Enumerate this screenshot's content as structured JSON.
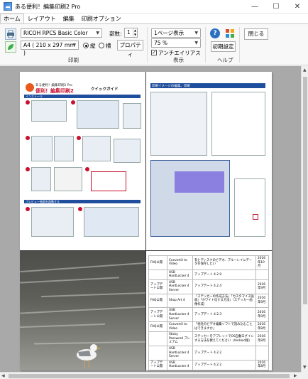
{
  "window": {
    "title": "ある便利！編集印刷2 Pro",
    "controls": [
      "—",
      "☐",
      "✕"
    ]
  },
  "tabs": [
    "ホーム",
    "レイアウト",
    "編集",
    "印刷オプション"
  ],
  "ribbon": {
    "printer": "RICOH RPCS Basic Color",
    "paper": "A4 ( 210 x 297 mm )",
    "copies_label": "部数:",
    "copies_value": "1",
    "orientation_portrait": "縦",
    "orientation_landscape": "横",
    "properties": "プロパティ",
    "print_group": "印刷",
    "pages_per_sheet": "1ページ表示",
    "zoom": "75 %",
    "antialias": "アンチエイリアス",
    "display_group": "表示",
    "reset": "初期設定",
    "help_group": "ヘルプ",
    "close": "閉じる"
  },
  "page1": {
    "brand_small": "ある便利！編集印刷2 Pro",
    "brand_big": "便利！編集印刷2",
    "quick_guide": "クイックガイド",
    "section1": "インストール",
    "section2": "プレビュー画面を起動する"
  },
  "page2": {
    "header": "印刷イメージの編集、印刷"
  },
  "table": {
    "rows": [
      [
        "FAQ公開",
        "ConvertX to Video",
        "有とディスクのビデオ、ブルーレイにデータを保存したい",
        "2016年10月"
      ],
      [
        "",
        "USB HardLocker 4",
        "アップデート 4.2.9",
        ""
      ],
      [
        "アップデート公開",
        "USB HardLocker 4 Server",
        "アップデート 4.2.4",
        "2016年9月"
      ],
      [
        "FAQ公開",
        "Shop Art 4",
        "「ステッカーの作成方法」「カスタマイズ画面」「ホワイト化する方法」（ステッカー画像作成）",
        "2016年9月"
      ],
      [
        "アップデート公開",
        "USB HardLocker 4 Server",
        "アップデート 4.2.3",
        "2016年9月"
      ],
      [
        "FAQ公開",
        "ConvertX to Video",
        "「他社のビデオ編集ソフトで読み込むことはできますか」",
        "2016年8月"
      ],
      [
        "",
        "Sticky Password プレミアム",
        "ステッカーをアプレットでOS自動ログインする方法を教えてください（Android版）",
        "2016年8月"
      ],
      [
        "",
        "USB HardLocker 4 Server",
        "アップデート 4.2.2",
        ""
      ],
      [
        "アップデート公開",
        "USB HardLocker 4",
        "アップデート 4.2.2",
        "2016年8月"
      ]
    ]
  }
}
